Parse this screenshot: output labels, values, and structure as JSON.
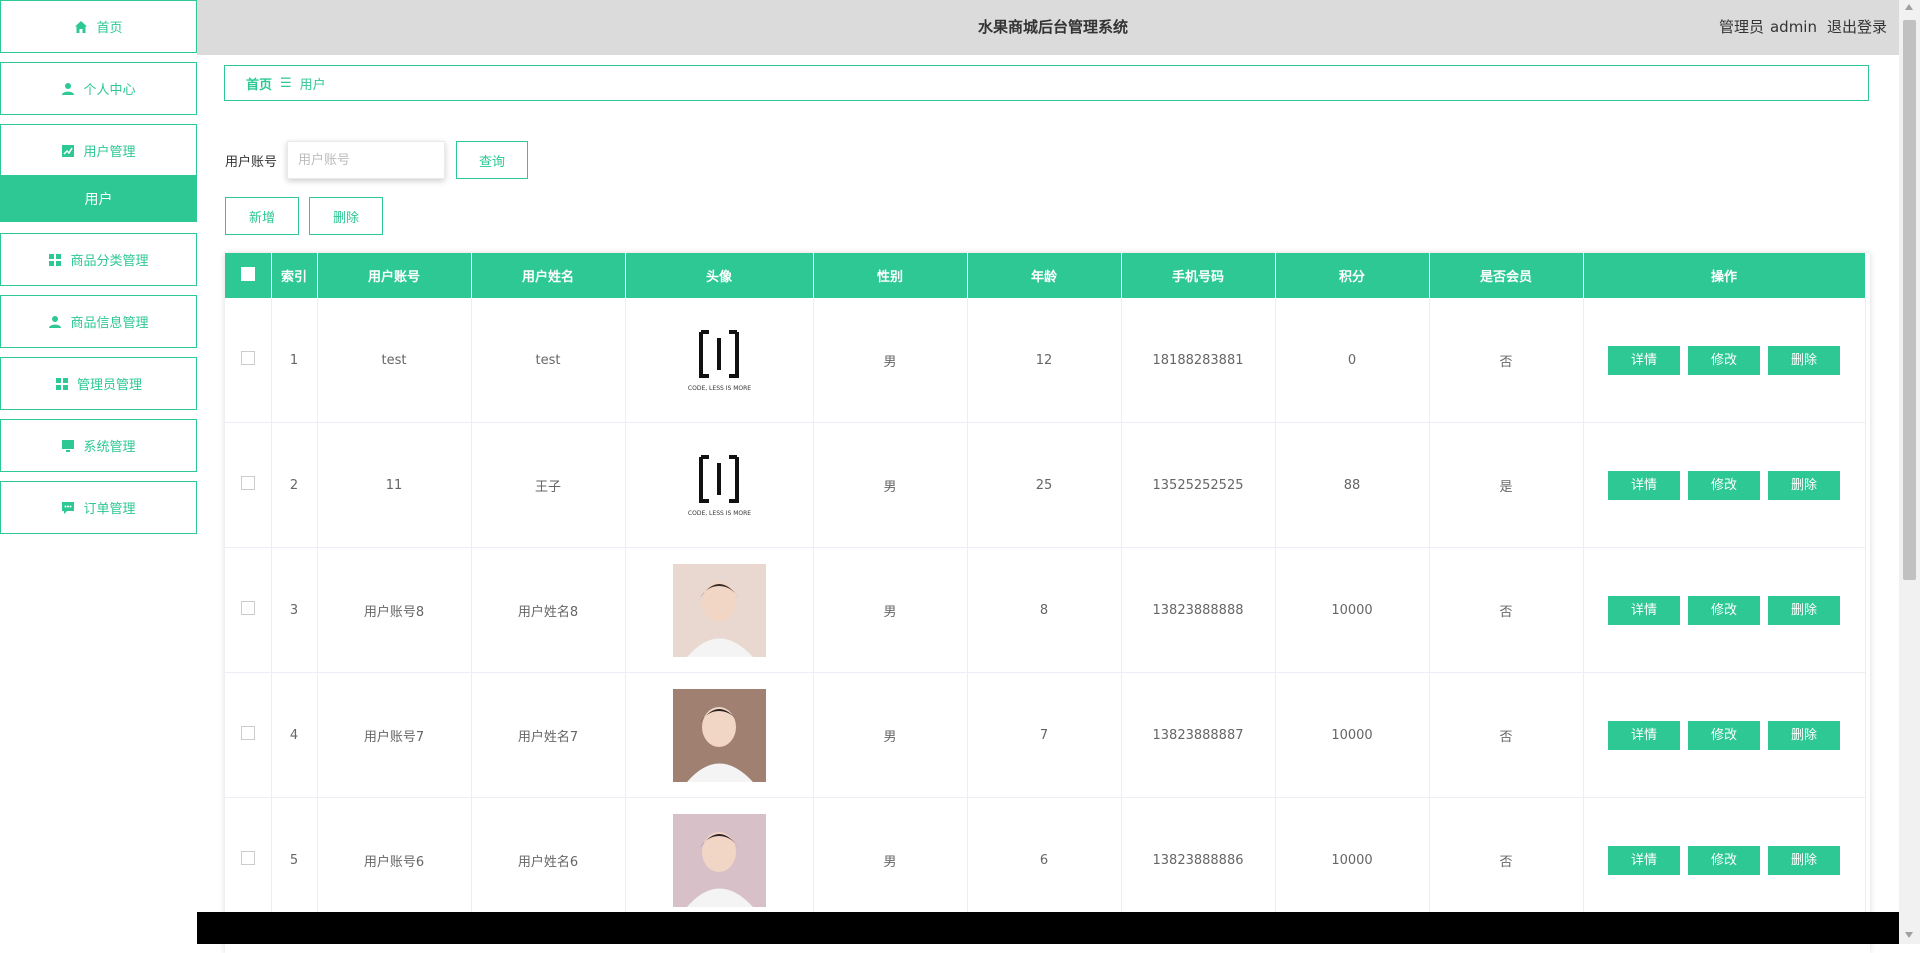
{
  "app_title": "水果商城后台管理系统",
  "user": {
    "role": "管理员",
    "name": "admin",
    "logout": "退出登录"
  },
  "sidebar": {
    "items": [
      {
        "label": "首页",
        "icon": "home-icon"
      },
      {
        "label": "个人中心",
        "icon": "person-icon"
      },
      {
        "label": "用户管理",
        "icon": "chart-icon"
      },
      {
        "label": "商品分类管理",
        "icon": "grid-icon"
      },
      {
        "label": "商品信息管理",
        "icon": "person-icon"
      },
      {
        "label": "管理员管理",
        "icon": "grid-icon"
      },
      {
        "label": "系统管理",
        "icon": "monitor-icon"
      },
      {
        "label": "订单管理",
        "icon": "chat-icon"
      }
    ],
    "sub_item": "用户"
  },
  "breadcrumb": {
    "home": "首页",
    "separator": "☰",
    "current": "用户"
  },
  "search": {
    "label": "用户账号",
    "placeholder": "用户账号",
    "button": "查询"
  },
  "actions": {
    "add": "新增",
    "delete": "删除"
  },
  "table": {
    "columns": [
      "索引",
      "用户账号",
      "用户姓名",
      "头像",
      "性别",
      "年龄",
      "手机号码",
      "积分",
      "是否会员",
      "操作"
    ],
    "op_buttons": [
      "详情",
      "修改",
      "删除"
    ],
    "rows": [
      {
        "index": "1",
        "account": "test",
        "name": "test",
        "avatar": "code-logo",
        "gender": "男",
        "age": "12",
        "phone": "18188283881",
        "points": "0",
        "member": "否"
      },
      {
        "index": "2",
        "account": "11",
        "name": "王子",
        "avatar": "code-logo",
        "gender": "男",
        "age": "25",
        "phone": "13525252525",
        "points": "88",
        "member": "是"
      },
      {
        "index": "3",
        "account": "用户账号8",
        "name": "用户姓名8",
        "avatar": "photo",
        "gender": "男",
        "age": "8",
        "phone": "13823888888",
        "points": "10000",
        "member": "否"
      },
      {
        "index": "4",
        "account": "用户账号7",
        "name": "用户姓名7",
        "avatar": "photo",
        "gender": "男",
        "age": "7",
        "phone": "13823888887",
        "points": "10000",
        "member": "否"
      },
      {
        "index": "5",
        "account": "用户账号6",
        "name": "用户姓名6",
        "avatar": "photo",
        "gender": "男",
        "age": "6",
        "phone": "13823888886",
        "points": "10000",
        "member": "否"
      }
    ]
  },
  "logo_text": "CODE, LESS IS MORE",
  "colors": {
    "accent": "#2dc893",
    "topbar": "#dcdbdb"
  }
}
